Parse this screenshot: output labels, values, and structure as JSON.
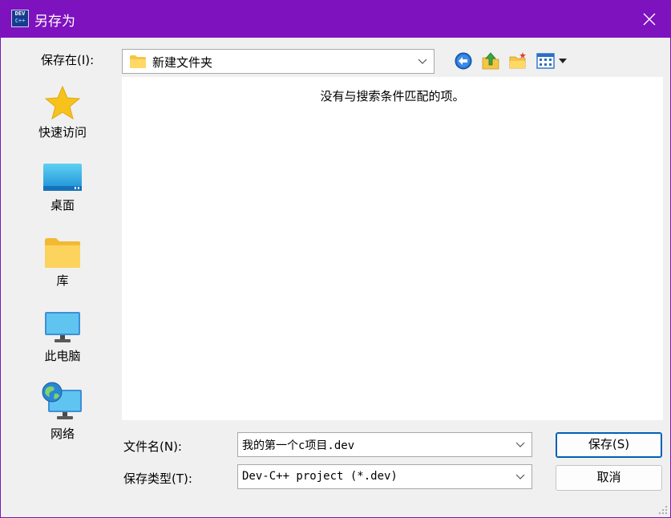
{
  "window": {
    "title": "另存为",
    "app_icon_line1": "DEV",
    "app_icon_line2": "C++"
  },
  "save_in": {
    "label": "保存在(I):",
    "current_folder": "新建文件夹"
  },
  "places": [
    {
      "label": "快速访问",
      "icon": "star-icon"
    },
    {
      "label": "桌面",
      "icon": "desktop-icon"
    },
    {
      "label": "库",
      "icon": "library-folder-icon"
    },
    {
      "label": "此电脑",
      "icon": "computer-icon"
    },
    {
      "label": "网络",
      "icon": "network-icon"
    }
  ],
  "file_list": {
    "empty_message": "没有与搜索条件匹配的项。"
  },
  "file_name": {
    "label": "文件名(N):",
    "value": "我的第一个c项目.dev"
  },
  "save_type": {
    "label": "保存类型(T):",
    "value": "Dev-C++ project (*.dev)"
  },
  "buttons": {
    "save": "保存(S)",
    "cancel": "取消"
  },
  "colors": {
    "titlebar": "#7d12be",
    "accent": "#005fb8"
  }
}
